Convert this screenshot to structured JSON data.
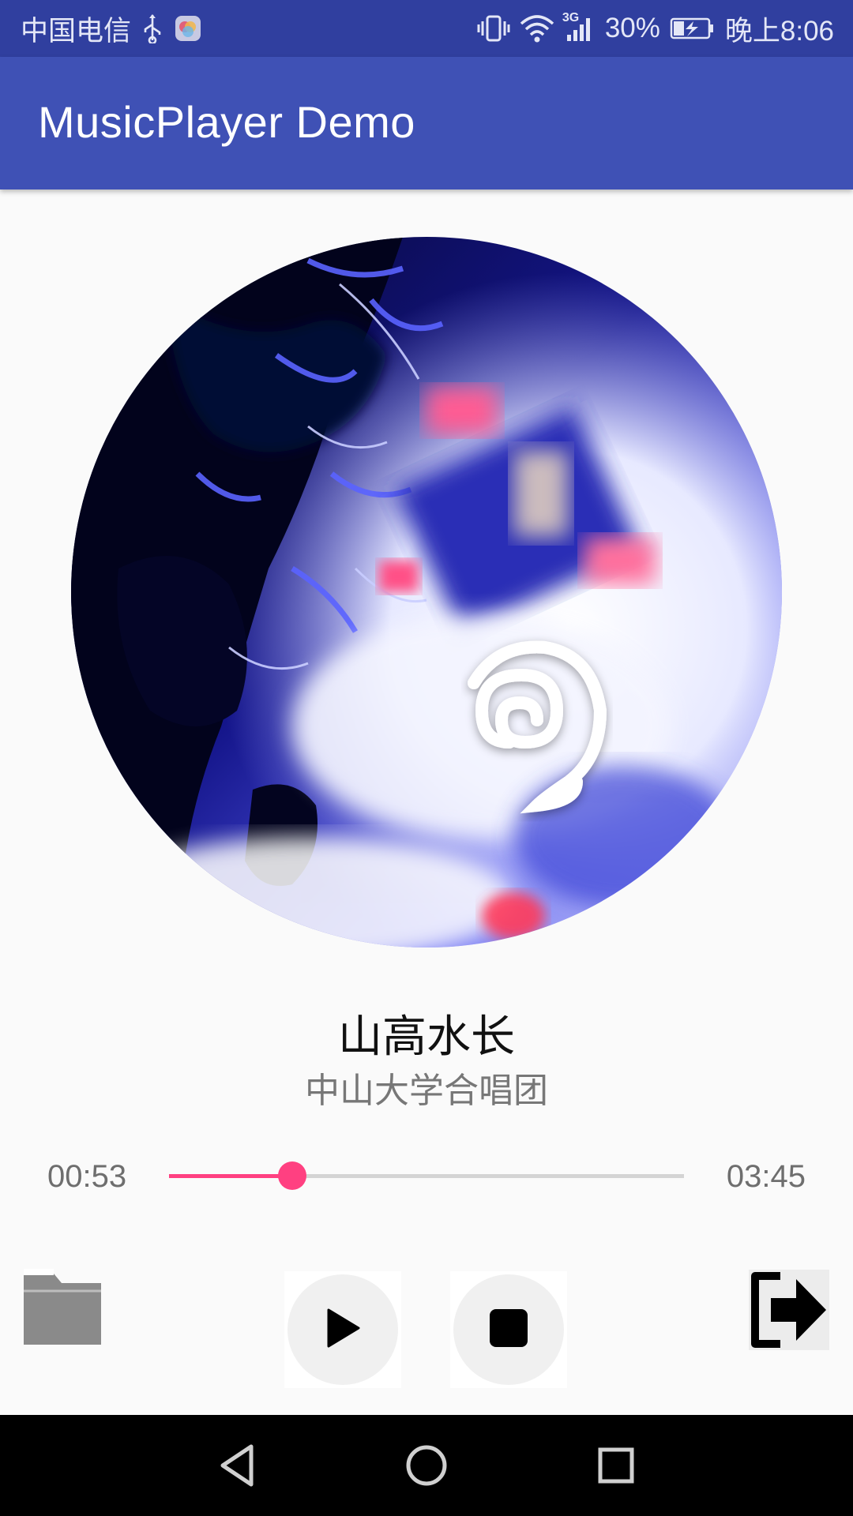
{
  "status_bar": {
    "carrier": "中国电信",
    "network": "3G",
    "battery": "30%",
    "time": "晚上8:06",
    "icons": [
      "usb-icon",
      "app-notification-icon",
      "vibrate-icon",
      "wifi-icon",
      "signal-icon",
      "battery-charging-icon"
    ]
  },
  "app_bar": {
    "title": "MusicPlayer Demo",
    "color": "#3f51b5",
    "status_color": "#303f9f"
  },
  "player": {
    "album_art_icon": "album-cover-image",
    "song_title": "山高水长",
    "artist": "中山大学合唱团",
    "current_time": "00:53",
    "total_time": "03:45",
    "progress": 0.24,
    "accent_color": "#ff4081"
  },
  "controls": {
    "open_icon": "folder-icon",
    "play_icon": "play-icon",
    "stop_icon": "stop-icon",
    "exit_icon": "exit-icon"
  },
  "nav_bar": {
    "icons": [
      "back-icon",
      "home-icon",
      "recents-icon"
    ]
  }
}
